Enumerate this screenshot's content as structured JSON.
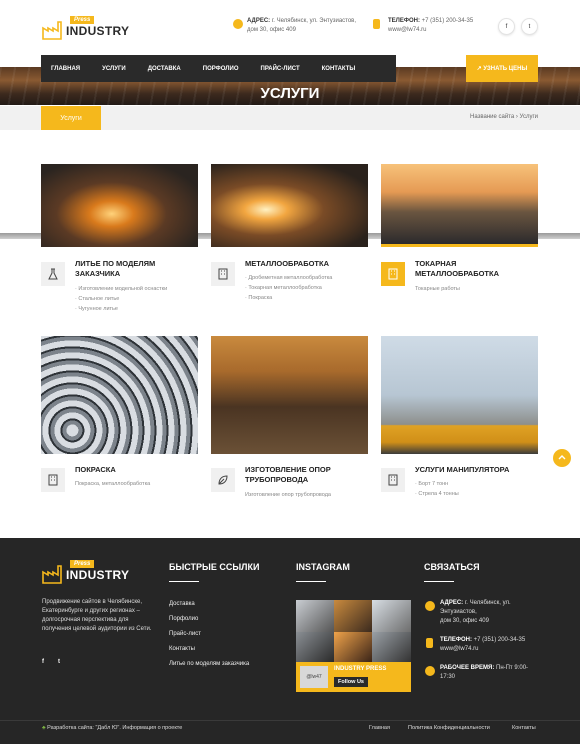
{
  "brand": {
    "press": "Press",
    "name": "INDUSTRY"
  },
  "header": {
    "address_label": "АДРЕС:",
    "address_l1": "г. Челябинск, ул. Энтузиастов,",
    "address_l2": "дом 30, офис 409",
    "phone_label": "ТЕЛЕФОН:",
    "phone": "+7 (351) 200-34-35",
    "site": "www@lw74.ru",
    "social": [
      "f",
      "t"
    ]
  },
  "nav": {
    "items": [
      "ГЛАВНАЯ",
      "УСЛУГИ",
      "ДОСТАВКА",
      "ПОРФОЛИО",
      "ПРАЙС-ЛИСТ",
      "КОНТАКТЫ"
    ],
    "price_button": "↗ УЗНАТЬ ЦЕНЫ"
  },
  "page": {
    "title": "УСЛУГИ",
    "tab": "Услуги",
    "crumb_site": "Название сайта",
    "crumb_sep": "›",
    "crumb_current": "Услуги"
  },
  "cards": [
    {
      "title_1": "ЛИТЬЕ ПО МОДЕЛЯМ",
      "title_2": "ЗАКАЗЧИКА",
      "lines": [
        "· Изготовление модельной оснастки",
        "· Стальное литье",
        "· Чугунное литье"
      ],
      "icon": "flask-icon"
    },
    {
      "title_1": "МЕТАЛЛООБРАБОТКА",
      "title_2": "",
      "lines": [
        "· Дробеметная металлообработка",
        "· Токарная металлообработка",
        "· Покраска"
      ],
      "icon": "building-icon"
    },
    {
      "title_1": "ТОКАРНАЯ",
      "title_2": "МЕТАЛЛООБРАБОТКА",
      "lines": [
        "Токарные работы"
      ],
      "icon": "building-icon"
    },
    {
      "title_1": "ПОКРАСКА",
      "title_2": "",
      "lines": [
        "Покраска, металлообработка"
      ],
      "icon": "building-icon"
    },
    {
      "title_1": "ИЗГОТОВЛЕНИЕ ОПОР",
      "title_2": "ТРУБОПРОВОДА",
      "lines": [
        "Изготовление опор трубопровода"
      ],
      "icon": "leaf-icon"
    },
    {
      "title_1": "УСЛУГИ МАНИПУЛЯТОРА",
      "title_2": "",
      "lines": [
        "· Борт 7 тонн",
        "· Стрела 4 тонны"
      ],
      "icon": "building-icon"
    }
  ],
  "footer": {
    "about": [
      "Продвижение сайтов в Челябинске,",
      "Екатеринбурге и других регионах –",
      "долгосрочная перспектива для",
      "получения целевой аудитории из Сети."
    ],
    "quick_title": "БЫСТРЫЕ ССЫЛКИ",
    "quick_links": [
      "Доставка",
      "Порфолио",
      "Прайс-лист",
      "Контакты",
      "Литье по моделям заказчика"
    ],
    "instagram_title": "INSTAGRAM",
    "insta_name": "INDUSTRY PRESS",
    "insta_handle": "@lw47",
    "insta_follow": "Follow Us",
    "contact_title": "СВЯЗАТЬСЯ",
    "c_addr_label": "АДРЕС:",
    "c_addr_1": "г. Челябинск, ул.",
    "c_addr_2": "Энтузиастов,",
    "c_addr_3": "дом 30, офис 409",
    "c_phone_label": "ТЕЛЕФОН:",
    "c_phone": "+7 (351) 200-34-35",
    "c_site": "www@lw74.ru",
    "c_hours_label": "РАБОЧЕЕ ВРЕМЯ:",
    "c_hours_1": "Пн-Пт 9:00-",
    "c_hours_2": "17:30",
    "dev": "Разработка сайта: \"Дабл Ю\". Информация о проекте",
    "bottom_links": [
      "Главная",
      "Политика Конфиденциальности",
      "Контакты"
    ]
  },
  "colors": {
    "accent": "#f5b81c",
    "dark": "#262626"
  }
}
